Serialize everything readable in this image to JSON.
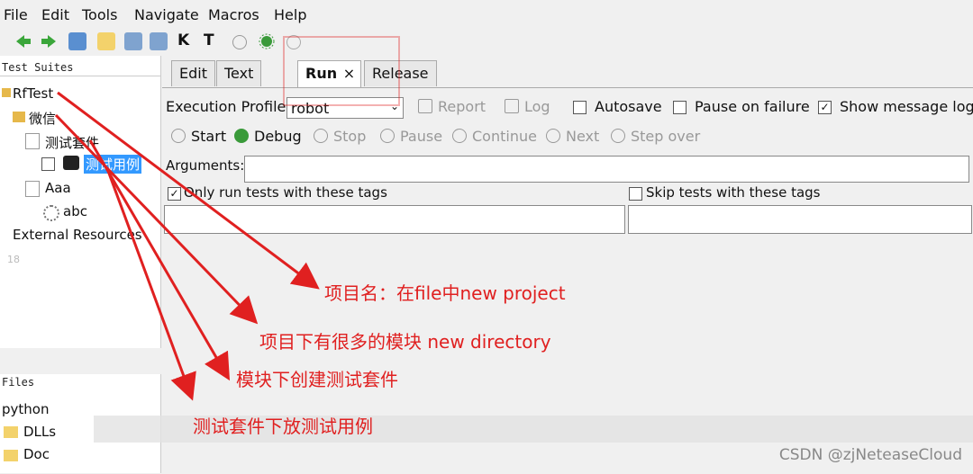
{
  "menu": [
    "File",
    "Edit",
    "Tools",
    "Navigate",
    "Macros",
    "Help"
  ],
  "toolbar": {
    "k_label": "K",
    "t_label": "T"
  },
  "tree": {
    "header": "Test Suites",
    "items": [
      "RfTest",
      "微信",
      "测试套件",
      "测试用例",
      "Aaa",
      "abc",
      "External Resources"
    ],
    "line_number": "18"
  },
  "files": {
    "header": "Files",
    "items": [
      "python",
      "DLLs",
      "Doc"
    ]
  },
  "tabs": [
    "Edit",
    "Text Edit",
    "Run",
    "Release Notes"
  ],
  "run": {
    "execution_profile_label": "Execution Profile:",
    "execution_profile_value": "robot",
    "report": "Report",
    "log": "Log",
    "autosave": "Autosave",
    "pause_on_failure": "Pause on failure",
    "show_message_log": "Show message log",
    "start": "Start",
    "debug": "Debug",
    "stop": "Stop",
    "pause": "Pause",
    "continue": "Continue",
    "next": "Next",
    "step_over": "Step over",
    "arguments_label": "Arguments:",
    "only_run_tags": "Only run tests with these tags",
    "skip_tags": "Skip tests with these tags"
  },
  "annotations": {
    "a1": "项目名：在file中new project",
    "a2": "项目下有很多的模块 new directory",
    "a3": "模块下创建测试套件",
    "a4": "测试套件下放测试用例"
  },
  "watermark": "CSDN @zjNeteaseCloud",
  "colors": {
    "accent": "#3399ff",
    "annotation": "#e02020"
  }
}
